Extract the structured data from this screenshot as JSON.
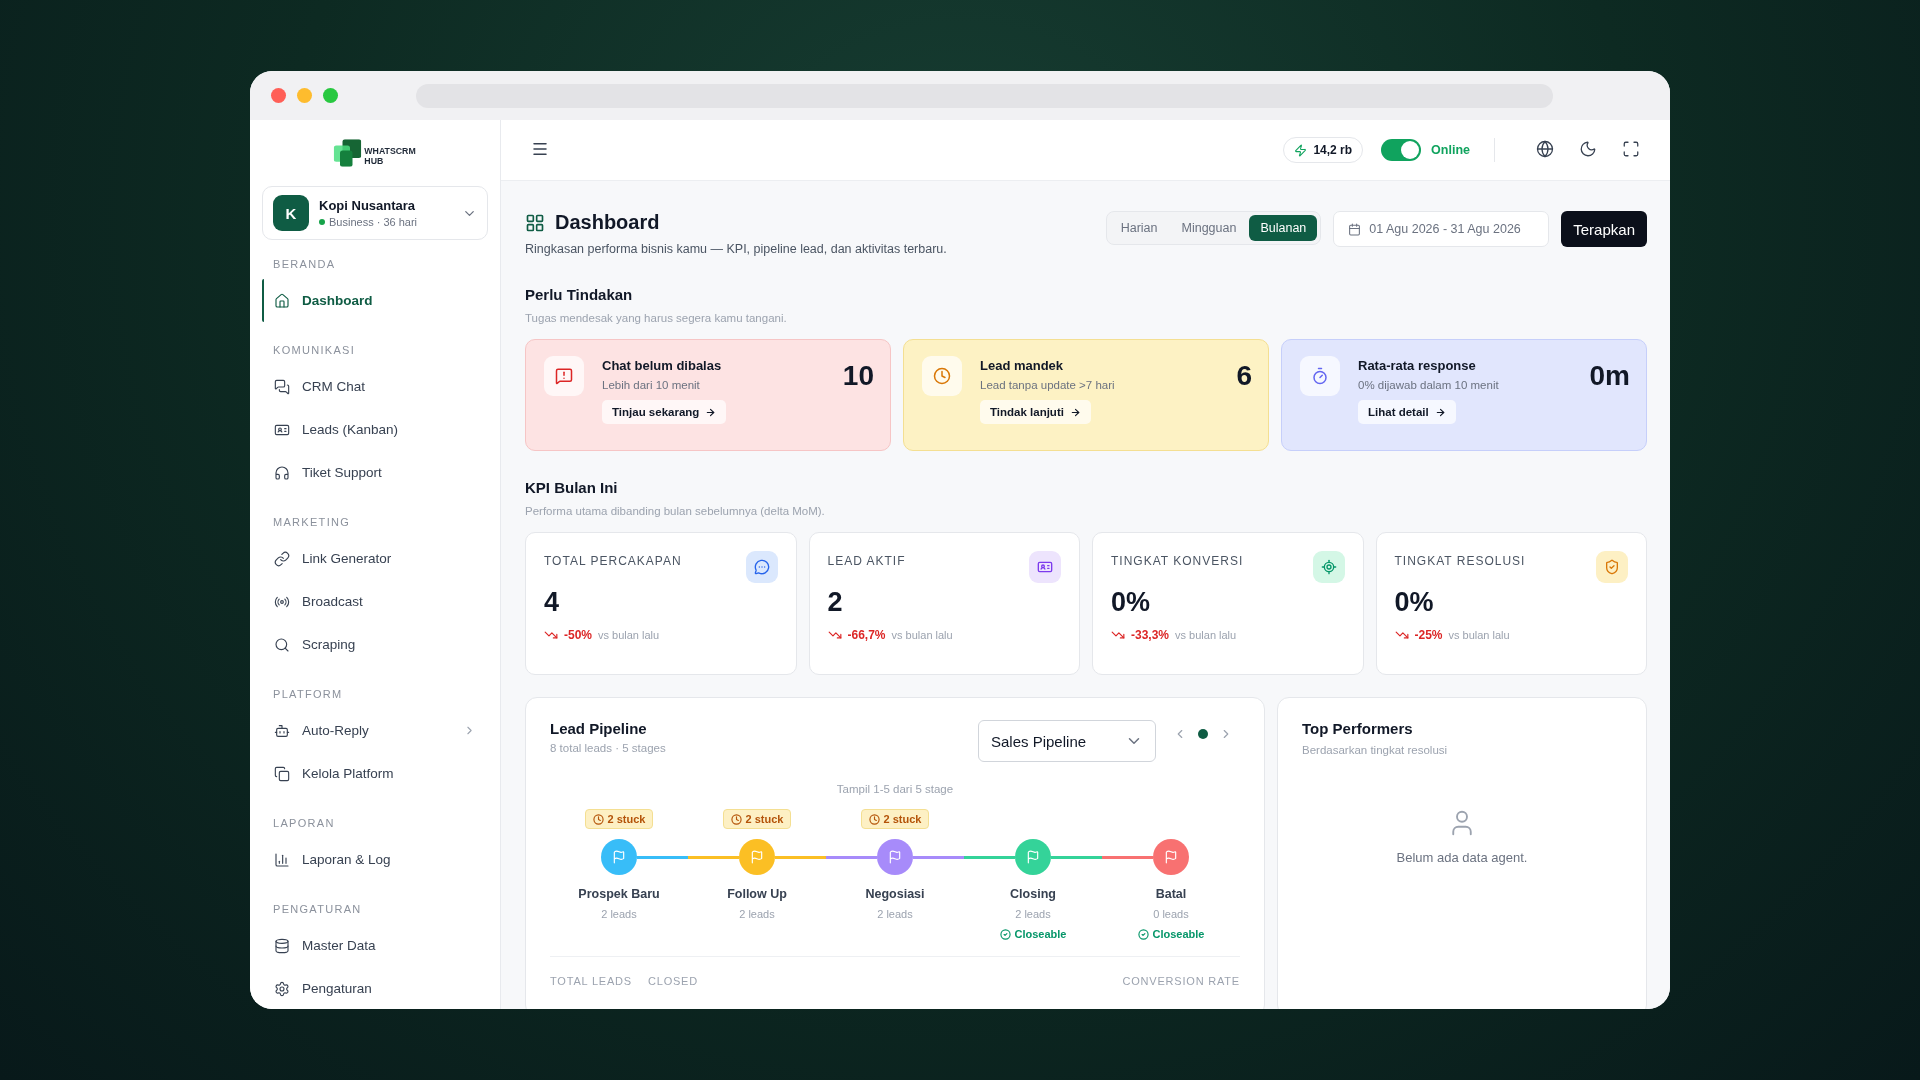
{
  "sidebar": {
    "logo": {
      "line1": "WHATSCRM",
      "line2": "HUB"
    },
    "workspace": {
      "initial": "K",
      "name": "Kopi Nusantara",
      "plan": "Business · 36 hari"
    },
    "sections": [
      {
        "title": "BERANDA",
        "items": [
          {
            "label": "Dashboard",
            "selected": true,
            "expandable": false
          }
        ]
      },
      {
        "title": "KOMUNIKASI",
        "items": [
          {
            "label": "CRM Chat",
            "selected": false,
            "expandable": false
          },
          {
            "label": "Leads (Kanban)",
            "selected": false,
            "expandable": false
          },
          {
            "label": "Tiket Support",
            "selected": false,
            "expandable": false
          }
        ]
      },
      {
        "title": "MARKETING",
        "items": [
          {
            "label": "Link Generator",
            "selected": false,
            "expandable": false
          },
          {
            "label": "Broadcast",
            "selected": false,
            "expandable": false
          },
          {
            "label": "Scraping",
            "selected": false,
            "expandable": false
          }
        ]
      },
      {
        "title": "PLATFORM",
        "items": [
          {
            "label": "Auto-Reply",
            "selected": false,
            "expandable": true
          },
          {
            "label": "Kelola Platform",
            "selected": false,
            "expandable": false
          }
        ]
      },
      {
        "title": "LAPORAN",
        "items": [
          {
            "label": "Laporan & Log",
            "selected": false,
            "expandable": false
          }
        ]
      },
      {
        "title": "PENGATURAN",
        "items": [
          {
            "label": "Master Data",
            "selected": false,
            "expandable": false
          },
          {
            "label": "Pengaturan",
            "selected": false,
            "expandable": false
          }
        ]
      }
    ]
  },
  "header": {
    "credits": "14,2 rb",
    "status": {
      "label": "Online",
      "on": true
    }
  },
  "page": {
    "title": "Dashboard",
    "subtitle": "Ringkasan performa bisnis kamu — KPI, pipeline lead, dan aktivitas terbaru.",
    "periods": [
      {
        "label": "Harian",
        "selected": false
      },
      {
        "label": "Mingguan",
        "selected": false
      },
      {
        "label": "Bulanan",
        "selected": true
      }
    ],
    "date_range": "01 Agu 2026 - 31 Agu 2026",
    "apply": "Terapkan"
  },
  "actions": {
    "title": "Perlu Tindakan",
    "subtitle": "Tugas mendesak yang harus segera kamu tangani.",
    "cards": [
      {
        "kind": "danger",
        "title": "Chat belum dibalas",
        "subtitle": "Lebih dari 10 menit",
        "value": "10",
        "button": "Tinjau sekarang"
      },
      {
        "kind": "warning",
        "title": "Lead mandek",
        "subtitle": "Lead tanpa update >7 hari",
        "value": "6",
        "button": "Tindak lanjuti"
      },
      {
        "kind": "info",
        "title": "Rata-rata response",
        "subtitle": "0% dijawab dalam 10 menit",
        "value": "0m",
        "button": "Lihat detail"
      }
    ]
  },
  "kpi": {
    "title": "KPI Bulan Ini",
    "subtitle": "Performa utama dibanding bulan sebelumnya (delta MoM).",
    "cards": [
      {
        "kind": "chat",
        "label": "TOTAL PERCAKAPAN",
        "value": "4",
        "delta": "-50%",
        "note": "vs bulan lalu"
      },
      {
        "kind": "lead",
        "label": "LEAD AKTIF",
        "value": "2",
        "delta": "-66,7%",
        "note": "vs bulan lalu"
      },
      {
        "kind": "conversion",
        "label": "TINGKAT KONVERSI",
        "value": "0%",
        "delta": "-33,3%",
        "note": "vs bulan lalu"
      },
      {
        "kind": "resolution",
        "label": "TINGKAT RESOLUSI",
        "value": "0%",
        "delta": "-25%",
        "note": "vs bulan lalu"
      }
    ]
  },
  "pipeline": {
    "title": "Lead Pipeline",
    "subtitle": "8 total leads · 5 stages",
    "select": "Sales Pipeline",
    "pages": [
      {
        "selected": true
      }
    ],
    "caption": "Tampil 1-5 dari 5 stage",
    "stages": [
      {
        "name": "Prospek Baru",
        "count": "2 leads",
        "stuck": "2 stuck",
        "color": "#38bdf8"
      },
      {
        "name": "Follow Up",
        "count": "2 leads",
        "stuck": "2 stuck",
        "color": "#fbbf24"
      },
      {
        "name": "Negosiasi",
        "count": "2 leads",
        "stuck": "2 stuck",
        "color": "#a78bfa"
      },
      {
        "name": "Closing",
        "count": "2 leads",
        "closeable": "Closeable",
        "color": "#34d399"
      },
      {
        "name": "Batal",
        "count": "0 leads",
        "closeable": "Closeable",
        "color": "#f87171"
      }
    ],
    "footer": [
      "TOTAL LEADS",
      "CLOSED"
    ],
    "footer_right": "CONVERSION RATE"
  },
  "performers": {
    "title": "Top Performers",
    "subtitle": "Berdasarkan tingkat resolusi",
    "empty": "Belum ada data agent."
  }
}
